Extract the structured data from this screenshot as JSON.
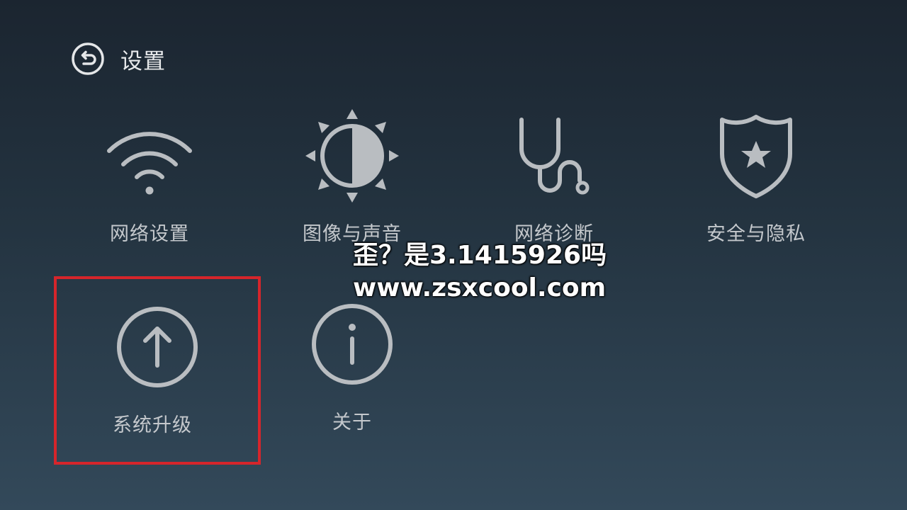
{
  "header": {
    "title": "设置"
  },
  "tiles": [
    {
      "label": "网络设置",
      "icon": "wifi-icon"
    },
    {
      "label": "图像与声音",
      "icon": "brightness-icon"
    },
    {
      "label": "网络诊断",
      "icon": "stethoscope-icon"
    },
    {
      "label": "安全与隐私",
      "icon": "shield-star-icon"
    },
    {
      "label": "系统升级",
      "icon": "upgrade-arrow-icon",
      "selected": true
    },
    {
      "label": "关于",
      "icon": "info-icon"
    }
  ],
  "watermark": {
    "line1": "歪？是3.1415926吗",
    "line2": "www.zsxcool.com"
  },
  "colors": {
    "icon": "#b9bdc1",
    "selection_border": "#d6252b",
    "title": "#e7e9eb"
  }
}
